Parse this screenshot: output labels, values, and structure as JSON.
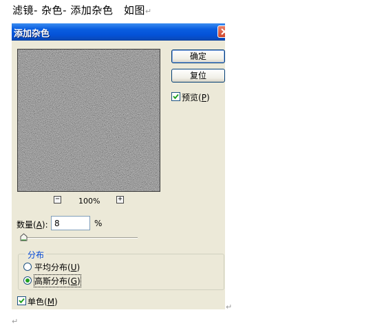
{
  "document": {
    "instruction": "滤镜- 杂色- 添加杂色　如图",
    "paragraph_mark": "↵"
  },
  "dialog": {
    "title": "添加杂色",
    "close_icon": "close-icon",
    "buttons": {
      "ok": "确定",
      "reset": "复位"
    },
    "preview_checkbox": {
      "label_prefix": "预览(",
      "accel": "P",
      "label_suffix": ")",
      "checked": true
    },
    "zoom": {
      "level": "100%",
      "minus": "−",
      "plus": "+"
    },
    "amount": {
      "label_prefix": "数量(",
      "accel": "A",
      "label_suffix": "):",
      "value": "8",
      "unit": "%"
    },
    "slider": {
      "value": 8
    },
    "distribution": {
      "title": "分布",
      "options": [
        {
          "label_prefix": "平均分布(",
          "accel": "U",
          "label_suffix": ")",
          "selected": false
        },
        {
          "label_prefix": "高斯分布(",
          "accel": "G",
          "label_suffix": ")",
          "selected": true
        }
      ]
    },
    "monochromatic_checkbox": {
      "label_prefix": "单色(",
      "accel": "M",
      "label_suffix": ")",
      "checked": true
    },
    "colors": {
      "titlebar": "#0452d8",
      "face": "#ece9d8",
      "check": "#21a121"
    }
  }
}
